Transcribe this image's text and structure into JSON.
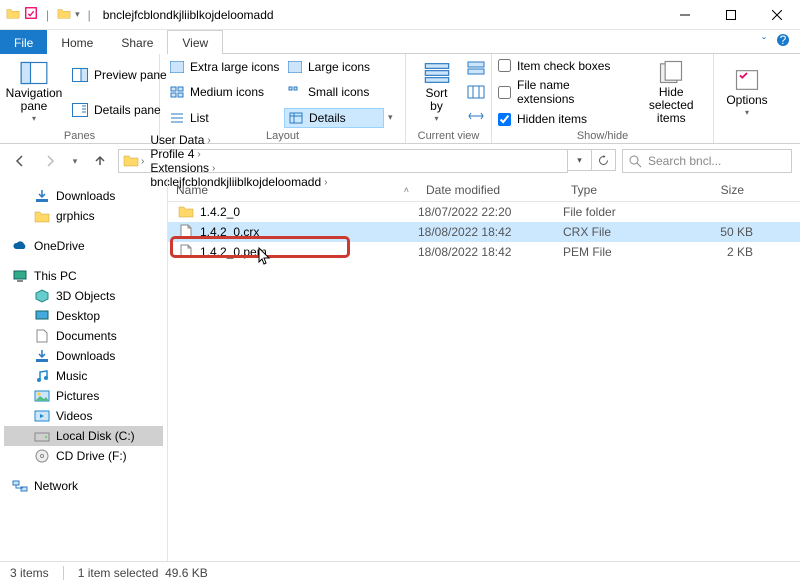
{
  "window": {
    "title": "bnclejfcblondkjliiblkojdeloomadd"
  },
  "menu": {
    "file": "File",
    "home": "Home",
    "share": "Share",
    "view": "View"
  },
  "ribbon": {
    "panes": {
      "nav": "Navigation\npane",
      "preview": "Preview pane",
      "details": "Details pane",
      "label": "Panes"
    },
    "layout": {
      "xl": "Extra large icons",
      "lg": "Large icons",
      "md": "Medium icons",
      "sm": "Small icons",
      "list": "List",
      "details": "Details",
      "label": "Layout"
    },
    "current": {
      "sort": "Sort\nby",
      "label": "Current view"
    },
    "showhide": {
      "checkboxes": "Item check boxes",
      "ext": "File name extensions",
      "hidden": "Hidden items",
      "hide": "Hide selected\nitems",
      "label": "Show/hide"
    },
    "options": "Options"
  },
  "breadcrumbs": [
    "User Data",
    "Profile 4",
    "Extensions",
    "bnclejfcblondkjliiblkojdeloomadd"
  ],
  "search_placeholder": "Search bncl...",
  "columns": {
    "name": "Name",
    "date": "Date modified",
    "type": "Type",
    "size": "Size"
  },
  "rows": [
    {
      "name": "1.4.2_0",
      "date": "18/07/2022 22:20",
      "type": "File folder",
      "size": "",
      "icon": "folder",
      "selected": false
    },
    {
      "name": "1.4.2_0.crx",
      "date": "18/08/2022 18:42",
      "type": "CRX File",
      "size": "50 KB",
      "icon": "file",
      "selected": true
    },
    {
      "name": "1.4.2_0.pem",
      "date": "18/08/2022 18:42",
      "type": "PEM File",
      "size": "2 KB",
      "icon": "file",
      "selected": false
    }
  ],
  "tree": {
    "quick": [
      {
        "label": "Downloads",
        "icon": "download"
      },
      {
        "label": "grphics",
        "icon": "folder"
      }
    ],
    "onedrive": "OneDrive",
    "thispc": "This PC",
    "pc": [
      {
        "label": "3D Objects"
      },
      {
        "label": "Desktop"
      },
      {
        "label": "Documents"
      },
      {
        "label": "Downloads"
      },
      {
        "label": "Music"
      },
      {
        "label": "Pictures"
      },
      {
        "label": "Videos"
      },
      {
        "label": "Local Disk (C:)",
        "selected": true
      },
      {
        "label": "CD Drive (F:)"
      }
    ],
    "network": "Network"
  },
  "status": {
    "items": "3 items",
    "selected": "1 item selected",
    "size": "49.6 KB"
  }
}
